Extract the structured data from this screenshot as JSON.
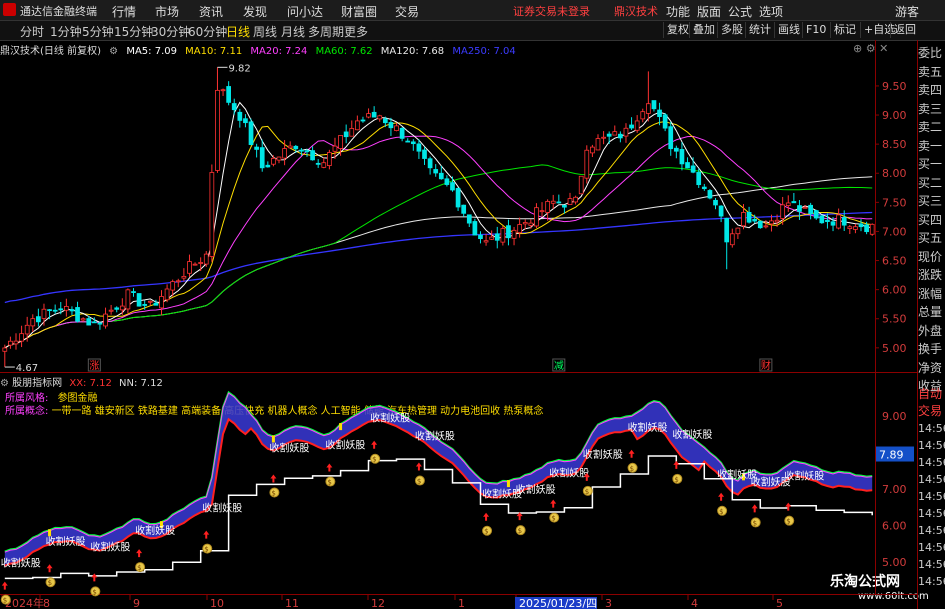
{
  "menubar": {
    "app_title": "通达信金融终端",
    "items": [
      "行情",
      "市场",
      "资讯",
      "发现",
      "问小达",
      "财富圈",
      "交易"
    ],
    "login_status": "证券交易未登录",
    "stock_tag": "鼎汉技术",
    "right_items": [
      "功能",
      "版面",
      "公式",
      "选项"
    ],
    "user": "游客"
  },
  "toolbar": {
    "periods": [
      "分时",
      "1分钟",
      "5分钟",
      "15分钟",
      "30分钟",
      "60分钟",
      "日线",
      "周线",
      "月线",
      "多周期",
      "更多"
    ],
    "active_period": "日线",
    "right_buttons": [
      "复权",
      "叠加",
      "多股",
      "统计",
      "画线",
      "F10",
      "标记",
      "+自选",
      "返回"
    ]
  },
  "colors": {
    "up": "#ff3232",
    "down": "#00e6e6",
    "ma5": "#ffffff",
    "ma10": "#ffde00",
    "ma20": "#ff40ff",
    "ma60": "#00e600",
    "ma120": "#e8e8e8",
    "ma250": "#3535ff",
    "sub_line": "#ffff00",
    "blue_band": "#4848ff"
  },
  "main_legend": {
    "name": "鼎汉技术(日线 前复权)",
    "ma5": "MA5: 7.09",
    "ma10": "MA10: 7.11",
    "ma20": "MA20: 7.24",
    "ma60": "MA60: 7.62",
    "ma120": "MA120: 7.68",
    "ma250": "MA250: 7.04"
  },
  "sub_legend": {
    "name": "股朋指标网",
    "xx": "XX: 7.12",
    "nn": "NN: 7.12"
  },
  "notes": {
    "style_label": "所属风格:",
    "style_value": "参图金融",
    "concept_label": "所属概念:",
    "concept_value": "一带一路 雄安新区 铁路基建 高端装备 高压快充 机器人概念 人工智能 储能 汽车热管理 动力电池回收 热泵概念"
  },
  "right_panel": {
    "quote_labels": [
      "委比",
      "卖五",
      "卖四",
      "卖三",
      "卖二",
      "卖一",
      "买一",
      "买二",
      "买三",
      "买四",
      "买五",
      "现价",
      "涨跌",
      "涨幅",
      "总量",
      "外盘",
      "换手",
      "净资",
      "收益"
    ],
    "auto_labels": [
      "自动",
      "交易"
    ],
    "times": [
      "14:56",
      "14:56",
      "14:56",
      "14:56",
      "14:56",
      "14:56",
      "14:56",
      "14:56",
      "14:56",
      "14:56"
    ]
  },
  "markers": {
    "high_label": "9.82",
    "low_label": "4.67",
    "crosshair_value": "7.89"
  },
  "events": [
    {
      "day": 16,
      "label": "涨",
      "color": "#ff3030"
    },
    {
      "day": 99,
      "label": "减",
      "color": "#00ff60"
    },
    {
      "day": 136,
      "label": "财",
      "color": "#ff3030"
    }
  ],
  "signal_text": "收割妖股",
  "chart_data": {
    "type": "candlestick",
    "x_labels": [
      "2024年",
      "8",
      "9",
      "10",
      "11",
      "12",
      "1",
      "2025/01/23/四",
      "3",
      "4",
      "5"
    ],
    "y_ticks": [
      9.5,
      9.0,
      8.5,
      8.0,
      7.5,
      7.0,
      6.5,
      6.0,
      5.5,
      5.0
    ],
    "sub_y_ticks": [
      9.0,
      8.0,
      7.0,
      6.0,
      5.0
    ],
    "ylim": [
      4.6,
      10.0
    ],
    "anchors": [
      [
        0,
        5.0
      ],
      [
        5,
        5.5
      ],
      [
        10,
        5.7
      ],
      [
        16,
        5.4
      ],
      [
        22,
        5.9
      ],
      [
        26,
        5.7
      ],
      [
        32,
        6.3
      ],
      [
        36,
        6.6
      ],
      [
        38,
        9.5
      ],
      [
        42,
        9.0
      ],
      [
        46,
        8.1
      ],
      [
        52,
        8.5
      ],
      [
        57,
        8.2
      ],
      [
        63,
        8.9
      ],
      [
        67,
        9.0
      ],
      [
        72,
        8.6
      ],
      [
        76,
        8.0
      ],
      [
        80,
        7.7
      ],
      [
        84,
        7.0
      ],
      [
        86,
        6.8
      ],
      [
        92,
        7.1
      ],
      [
        98,
        7.5
      ],
      [
        102,
        7.5
      ],
      [
        104,
        8.5
      ],
      [
        108,
        8.6
      ],
      [
        111,
        8.7
      ],
      [
        115,
        9.3
      ],
      [
        119,
        8.5
      ],
      [
        124,
        7.9
      ],
      [
        127,
        7.5
      ],
      [
        129,
        6.9
      ],
      [
        132,
        7.3
      ],
      [
        136,
        7.1
      ],
      [
        140,
        7.5
      ],
      [
        145,
        7.2
      ],
      [
        150,
        7.2
      ],
      [
        154,
        7.1
      ]
    ]
  }
}
